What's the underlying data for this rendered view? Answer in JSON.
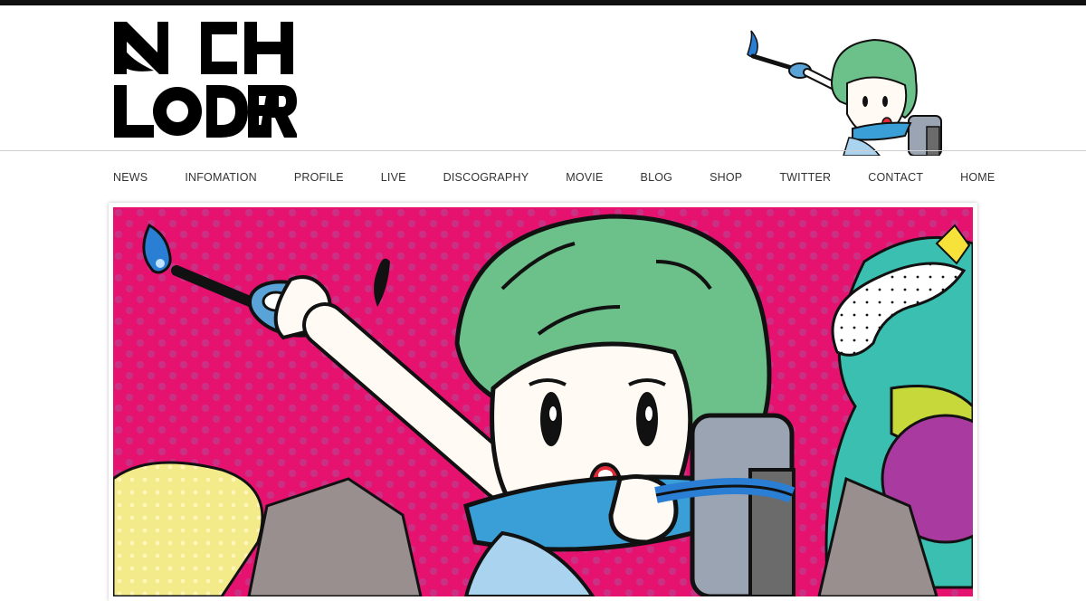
{
  "site": {
    "logo_text_line1": "SCH",
    "logo_text_line2": "LODER",
    "logo_icon": "schloder-logo"
  },
  "nav": {
    "items": [
      {
        "label": "NEWS"
      },
      {
        "label": "INFOMATION"
      },
      {
        "label": "PROFILE"
      },
      {
        "label": "LIVE"
      },
      {
        "label": "DISCOGRAPHY"
      },
      {
        "label": "MOVIE"
      },
      {
        "label": "BLOG"
      },
      {
        "label": "SHOP"
      },
      {
        "label": "TWITTER"
      },
      {
        "label": "CONTACT"
      },
      {
        "label": "HOME"
      }
    ]
  },
  "hero": {
    "image": "green-haired-girl-illustration"
  },
  "colors": {
    "hero_background": "#e5136f",
    "hair_green": "#6cc08a",
    "outline": "#111111",
    "nav_text": "#333333"
  }
}
